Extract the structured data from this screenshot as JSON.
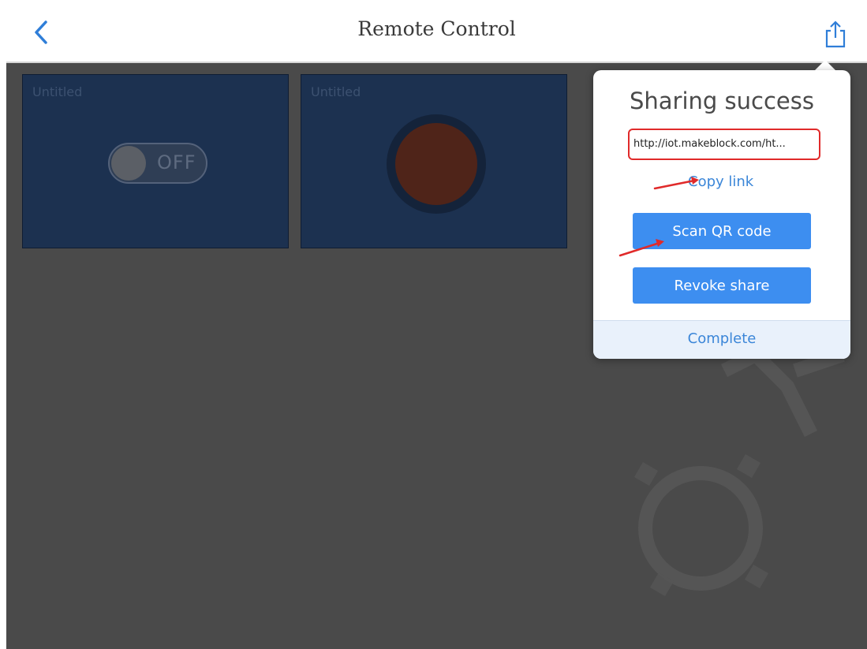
{
  "navbar": {
    "title": "Remote Control",
    "back_icon": "chevron-left-icon",
    "share_icon": "share-icon"
  },
  "widgets": [
    {
      "label": "Untitled",
      "type": "switch",
      "state_text": "OFF"
    },
    {
      "label": "Untitled",
      "type": "button"
    }
  ],
  "popover": {
    "title": "Sharing success",
    "link_value": "http://iot.makeblock.com/ht...",
    "copy_link_label": "Copy link",
    "scan_qr_label": "Scan QR code",
    "revoke_label": "Revoke share",
    "complete_label": "Complete"
  },
  "colors": {
    "accent": "#3d8ef0",
    "link": "#3b86d8",
    "annotation": "#e02a2a",
    "background": "#4a4a4a",
    "widget": "#1c3150"
  }
}
